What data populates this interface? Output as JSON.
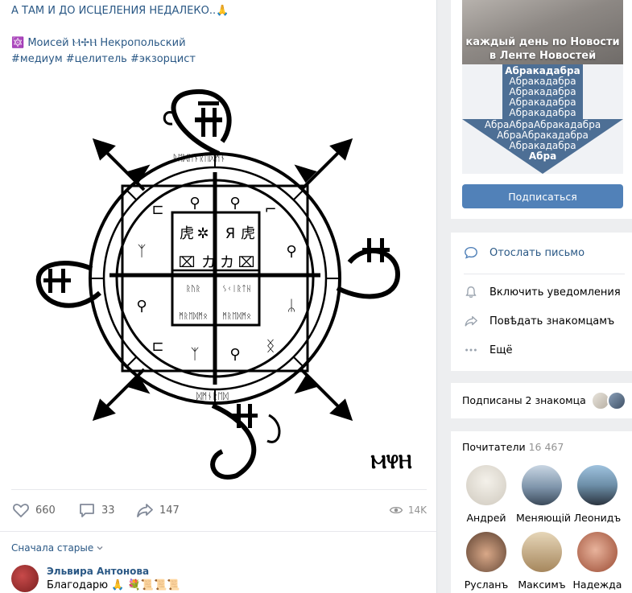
{
  "post": {
    "title": "А ТАМ И ДО ИСЦЕЛЕНИЯ НЕДАЛЕКО..🙏",
    "author": "🔯 Моисей Ⲙ✢Ⲏ Некропольский",
    "tags": "#медиум #целитель #экзорцист",
    "image_mark": "ⲘⳠⲎ",
    "likes": "660",
    "comments": "33",
    "shares": "147",
    "views": "14K"
  },
  "comments": {
    "sort_label": "Сначала старые",
    "items": [
      {
        "author": "Эльвира Антонова",
        "text": "Благодарю 🙏 💐📜📜📜"
      }
    ]
  },
  "promo": {
    "caption_line1": "каждый день по Новости",
    "caption_line2": "в Ленте Новостей",
    "abra_lines": [
      "Абракадабра",
      "Абракадабра",
      "Абракадабра",
      "Абракадабра",
      "Абракадабра",
      "АбраАбраАбракадабра",
      "АбраАбракадабра",
      "Абракадабра",
      "Абра"
    ],
    "subscribe_label": "Подписаться"
  },
  "menu": {
    "send_message": "Отослать письмо",
    "notifications": "Включить уведомления",
    "share": "Повѣдать знакомцамъ",
    "more": "Ещё"
  },
  "friends": {
    "label": "Подписаны 2 знакомца"
  },
  "fans": {
    "title": "Почитатели",
    "count": "16 467",
    "items": [
      {
        "name": "Андрей"
      },
      {
        "name": "Меняющій"
      },
      {
        "name": "Леонидъ"
      },
      {
        "name": "Русланъ"
      },
      {
        "name": "Максимъ"
      },
      {
        "name": "Надежда"
      }
    ]
  },
  "colors": {
    "link": "#2a5885",
    "button": "#5181b8",
    "arrow": "#4d6f95"
  }
}
